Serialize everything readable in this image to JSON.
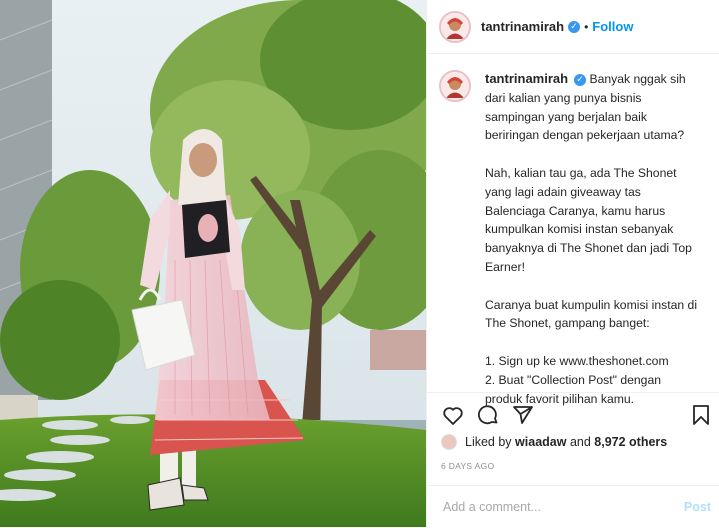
{
  "post": {
    "username": "tantrinamirah",
    "follow_label": "Follow",
    "dot": "•",
    "verified_glyph": "✓",
    "caption_paragraphs": [
      "Banyak nggak sih dari kalian yang punya bisnis sampingan yang berjalan baik beriringan dengan pekerjaan utama?",
      "Nah, kalian tau ga, ada The Shonet yang lagi adain giveaway tas Balenciaga Caranya, kamu harus kumpulkan komisi instan sebanyak banyaknya di The Shonet dan jadi Top Earner!",
      "Caranya buat kumpulin komisi instan di The Shonet, gampang banget:",
      "1. Sign up ke www.theshonet.com\n2. Buat \"Collection Post\" dengan produk favorit pilihan kamu."
    ],
    "likes_prefix": "Liked by",
    "likes_user": "wiaadaw",
    "likes_and": "and",
    "likes_count": "8,972 others",
    "time_ago": "6 DAYS AGO",
    "comment_placeholder": "Add a comment...",
    "post_button": "Post"
  },
  "icons": {
    "like": "heart-icon",
    "comment": "comment-icon",
    "share": "share-icon",
    "save": "bookmark-icon",
    "verified": "verified-badge-icon"
  },
  "colors": {
    "accent": "#0095f6",
    "verified": "#3897f0",
    "muted": "#8e8e8e",
    "border": "#efefef"
  }
}
